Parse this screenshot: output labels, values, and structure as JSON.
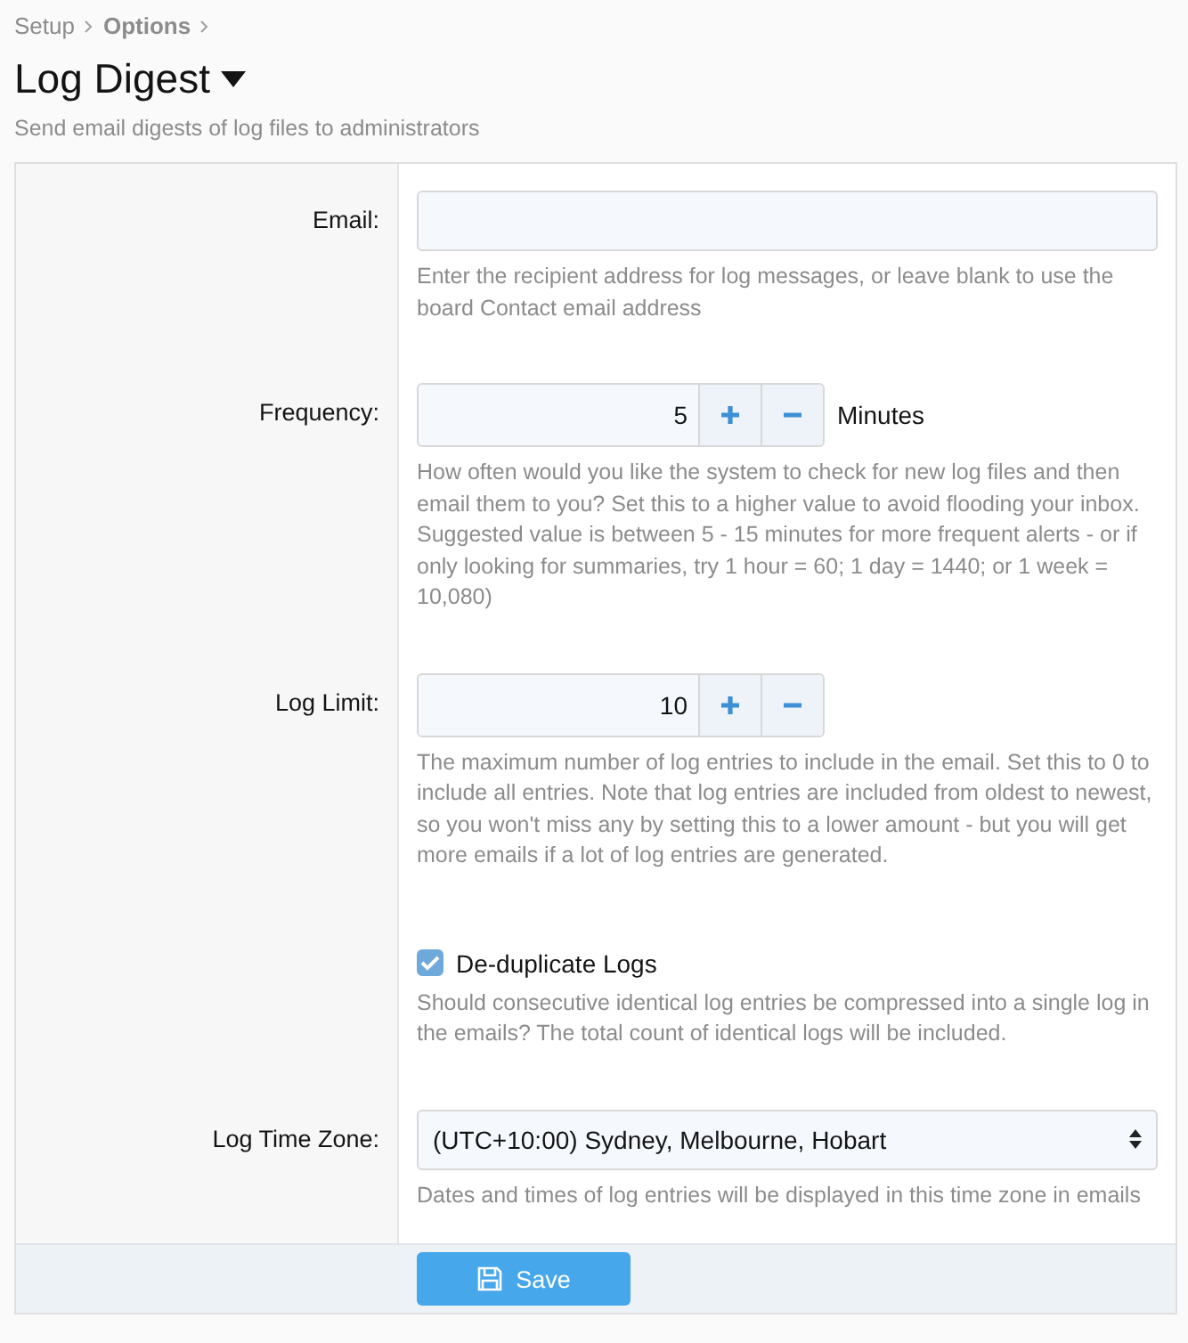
{
  "breadcrumbs": [
    {
      "label": "Setup",
      "current": false
    },
    {
      "label": "Options",
      "current": true
    }
  ],
  "title": "Log Digest",
  "description": "Send email digests of log files to administrators",
  "options": [
    {
      "kind": "text",
      "label": "Email:",
      "hint": "Enter the recipient address for log messages, or leave blank to use the board Contact email address"
    },
    {
      "kind": "number",
      "label": "Frequency:",
      "value": "5",
      "unit": "Minutes",
      "hint": "How often would you like the system to check for new log files and then email them to you? Set this to a higher value to avoid flooding your inbox. Suggested value is between 5 - 15 minutes for more frequent alerts - or if only looking for summaries, try 1 hour = 60; 1 day = 1440; or 1 week = 10,080)"
    },
    {
      "kind": "number",
      "label": "Log Limit:",
      "value": "10",
      "hint": "The maximum number of log entries to include in the email. Set this to 0 to include all entries. Note that log entries are included from oldest to newest, so you won't miss any by setting this to a lower amount - but you will get more emails if a lot of log entries are generated."
    },
    {
      "kind": "checkbox",
      "checked": true,
      "text": "De-duplicate Logs",
      "hint": "Should consecutive identical log entries be compressed into a single log in the emails? The total count of identical logs will be included."
    },
    {
      "kind": "select",
      "label": "Log Time Zone:",
      "value": "(UTC+10:00) Sydney, Melbourne, Hobart",
      "hint": "Dates and times of log entries will be displayed in this time zone in emails"
    }
  ],
  "save_button": "Save"
}
